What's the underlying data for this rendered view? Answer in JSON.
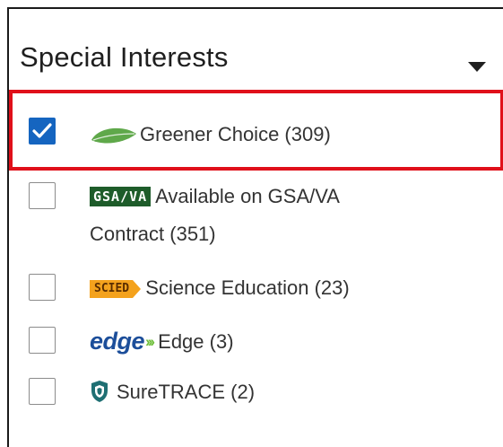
{
  "filter": {
    "title": "Special Interests",
    "items": [
      {
        "label": "Greener Choice (309)",
        "checked": true,
        "logo": "leaf-icon"
      },
      {
        "label_line1": "Available on GSA/VA",
        "label_line2": "Contract (351)",
        "checked": false,
        "logo_text": "GSA/VA"
      },
      {
        "label": "Science Education (23)",
        "checked": false,
        "logo_text": "SCIED"
      },
      {
        "label": "Edge (3)",
        "checked": false,
        "logo_text": "edge"
      },
      {
        "label": "SureTRACE (2)",
        "checked": false,
        "logo": "shield-icon"
      }
    ]
  },
  "colors": {
    "highlight": "#e0101a",
    "checkbox_checked": "#1565c0",
    "leaf": "#5fa84a",
    "gsa": "#1e5c2a",
    "scied": "#f4a21d",
    "edge": "#1c4e9a",
    "suretrace": "#1f6f73"
  }
}
